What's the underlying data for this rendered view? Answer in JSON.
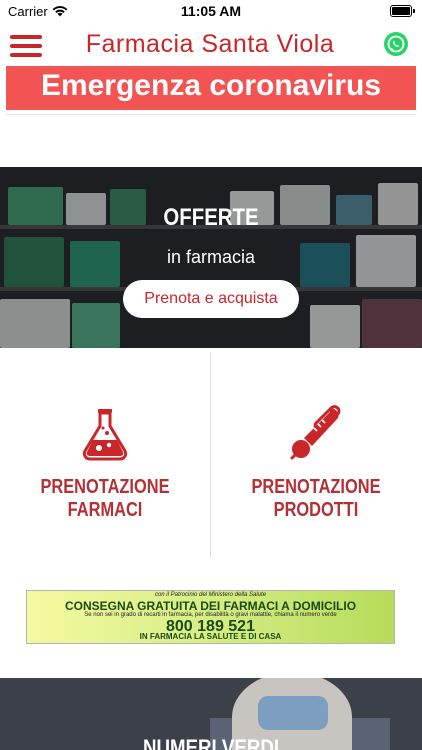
{
  "status_bar": {
    "carrier": "Carrier",
    "time": "11:05 AM"
  },
  "header": {
    "title": "Farmacia Santa Viola"
  },
  "banner": {
    "text": "Emergenza coronavirus"
  },
  "hero": {
    "title": "OFFERTE",
    "subtitle": "in farmacia",
    "button_label": "Prenota e acquista"
  },
  "services": [
    {
      "label": "PRENOTAZIONE FARMACI",
      "icon": "flask-icon"
    },
    {
      "label": "PRENOTAZIONE PRODOTTI",
      "icon": "thermometer-icon"
    }
  ],
  "promo": {
    "line1": "con il Patrocinio del        Ministero della Salute",
    "line2": "CONSEGNA GRATUITA DEI FARMACI A DOMICILIO",
    "line3": "Se non sei in grado di recarti in farmacia, per disabilità o gravi malattie, chiama il numero verde",
    "line4": "800 189 521",
    "line5": "IN FARMACIA LA SALUTE E DI CASA"
  },
  "bottom": {
    "title": "NUMERI VERDI"
  },
  "colors": {
    "brand_red": "#c9262a",
    "banner_red": "#f25454",
    "whatsapp_green": "#25d366"
  }
}
